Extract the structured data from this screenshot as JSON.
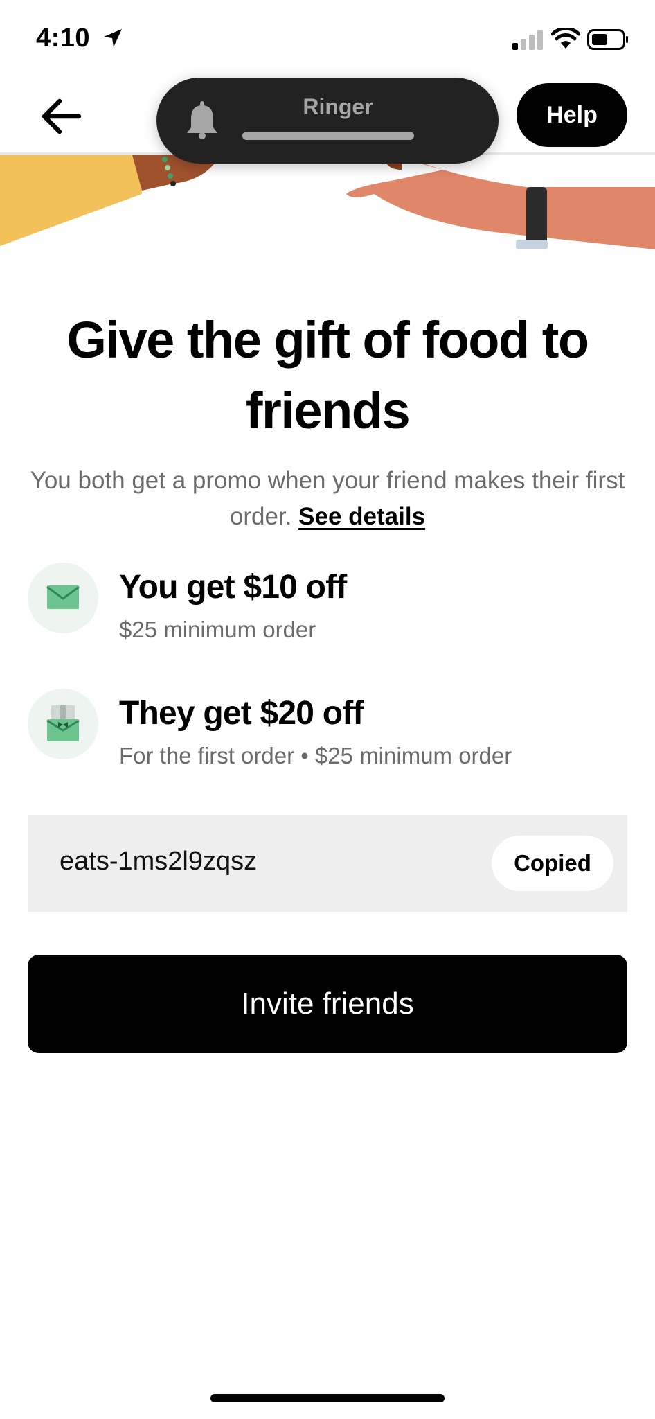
{
  "status_bar": {
    "time": "4:10"
  },
  "header": {
    "ringer_label": "Ringer",
    "help_label": "Help"
  },
  "main": {
    "headline": "Give the gift of food to friends",
    "subtitle": "You both get a promo when your friend makes their first order.",
    "details_link": "See details",
    "perks": [
      {
        "title": "You get $10 off",
        "description": "$25 minimum order",
        "icon": "envelope-icon"
      },
      {
        "title": "They get $20 off",
        "description": "For the first order • $25 minimum order",
        "icon": "gift-envelope-icon"
      }
    ],
    "promo_code": "eats-1ms2l9zqsz",
    "copy_label": "Copied",
    "invite_label": "Invite friends"
  },
  "colors": {
    "accent_green": "#3fa26b",
    "hand_left_color": "#f2c159",
    "hand_right_color": "#e0876a"
  }
}
